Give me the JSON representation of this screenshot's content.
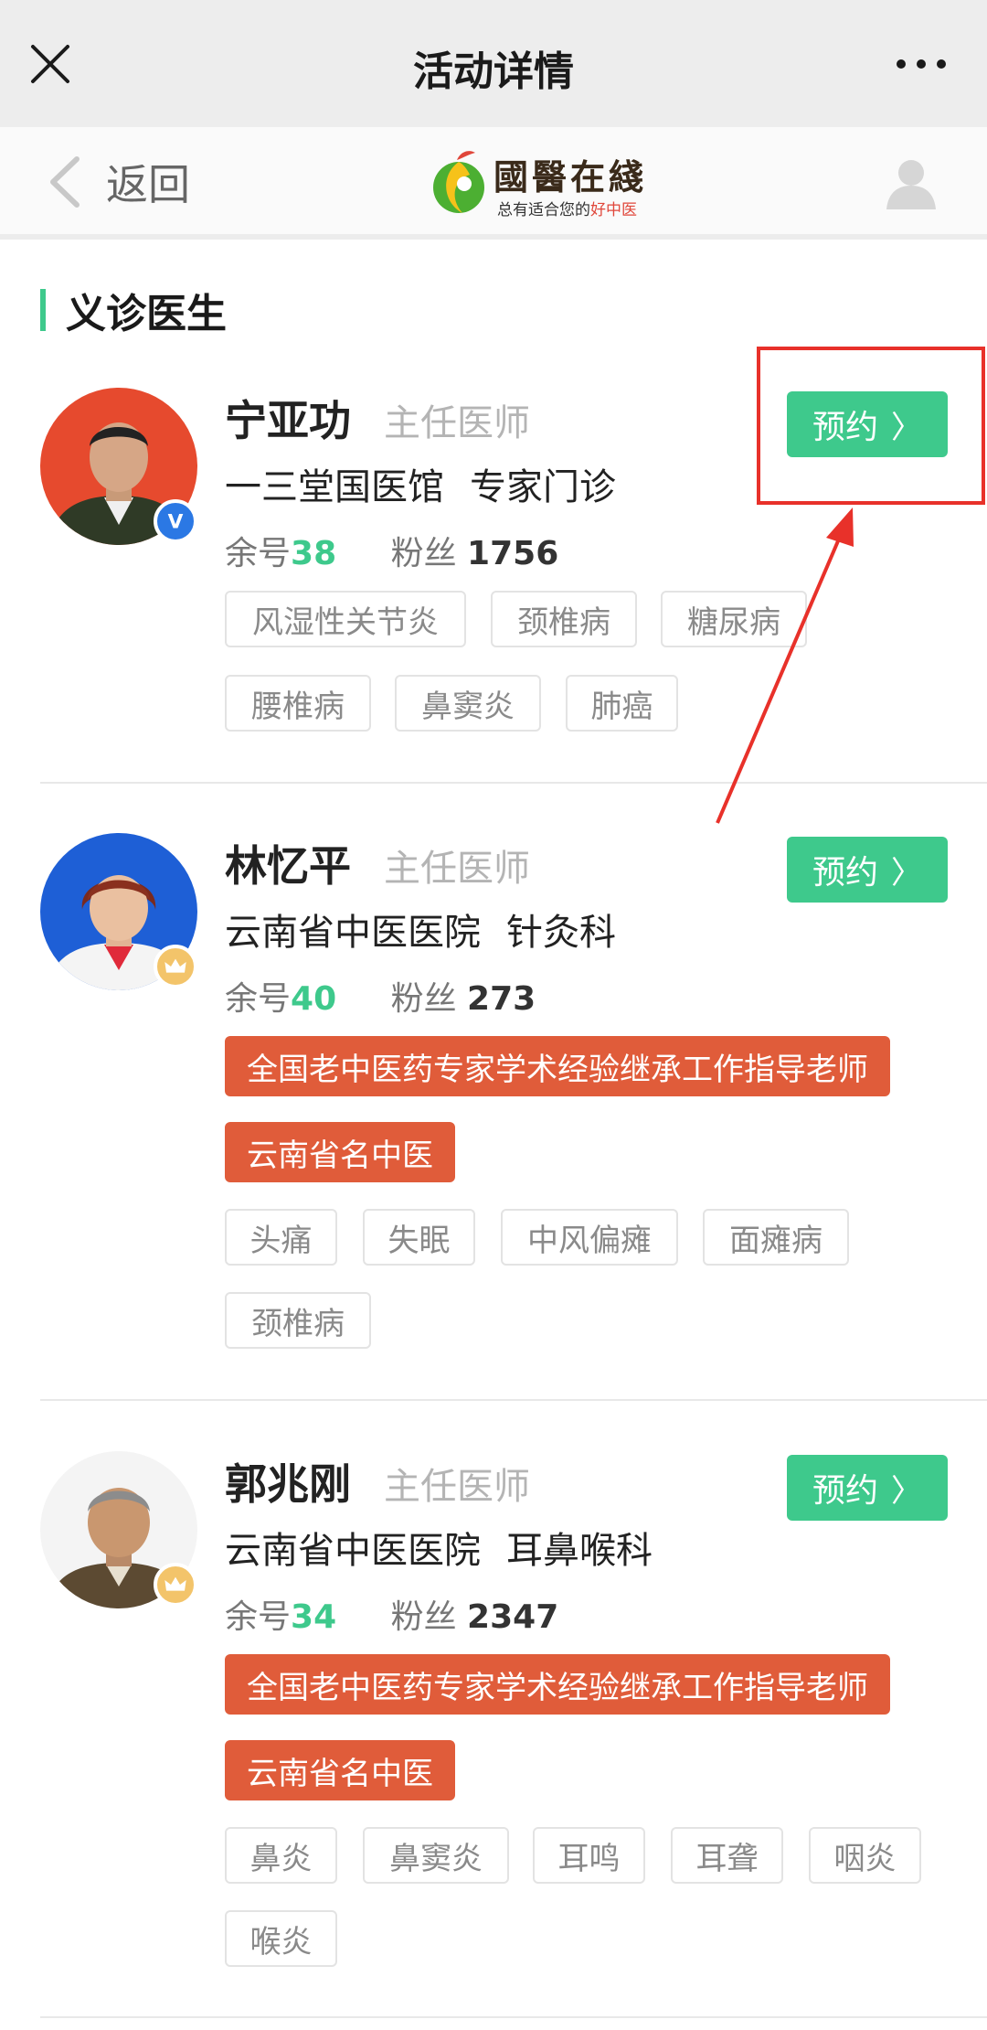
{
  "topbar": {
    "title": "活动详情",
    "close_icon": "close-icon",
    "more_icon": "more-icon"
  },
  "nav": {
    "back_label": "返回",
    "logo": {
      "brand": "國醫在綫",
      "slogan_main": "总有适合您的",
      "slogan_highlight": "好中医"
    },
    "user_icon": "user-icon"
  },
  "section": {
    "title": "义诊医生"
  },
  "colors": {
    "accent": "#3ec98c",
    "honor": "#e05c3a",
    "annotation": "#e8312a"
  },
  "doctors": [
    {
      "name": "宁亚功",
      "title": "主任医师",
      "hospital": "一三堂国医馆",
      "dept": "专家门诊",
      "remaining_label": "余号",
      "remaining": "38",
      "fans_label": "粉丝",
      "fans": "1756",
      "badge": "verified-icon",
      "book_label": "预约",
      "honors": [],
      "tags": [
        "风湿性关节炎",
        "颈椎病",
        "糖尿病",
        "腰椎病",
        "鼻窦炎",
        "肺癌"
      ]
    },
    {
      "name": "林忆平",
      "title": "主任医师",
      "hospital": "云南省中医医院",
      "dept": "针灸科",
      "remaining_label": "余号",
      "remaining": "40",
      "fans_label": "粉丝",
      "fans": "273",
      "badge": "crown-icon",
      "book_label": "预约",
      "honors": [
        "全国老中医药专家学术经验继承工作指导老师",
        "云南省名中医"
      ],
      "tags": [
        "头痛",
        "失眠",
        "中风偏瘫",
        "面瘫病",
        "颈椎病"
      ]
    },
    {
      "name": "郭兆刚",
      "title": "主任医师",
      "hospital": "云南省中医医院",
      "dept": "耳鼻喉科",
      "remaining_label": "余号",
      "remaining": "34",
      "fans_label": "粉丝",
      "fans": "2347",
      "badge": "crown-icon",
      "book_label": "预约",
      "honors": [
        "全国老中医药专家学术经验继承工作指导老师",
        "云南省名中医"
      ],
      "tags": [
        "鼻炎",
        "鼻窦炎",
        "耳鸣",
        "耳聋",
        "咽炎",
        "喉炎"
      ]
    }
  ]
}
